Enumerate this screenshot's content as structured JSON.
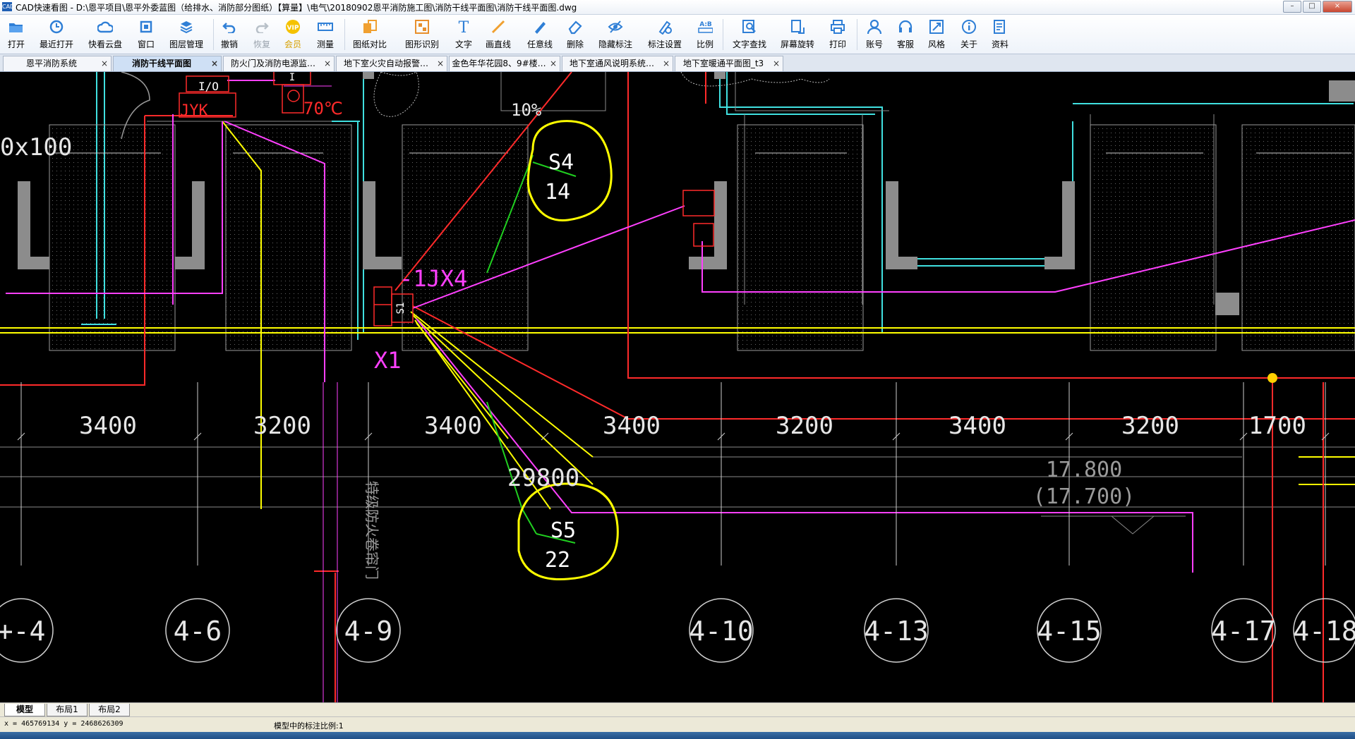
{
  "window": {
    "title": "CAD快速看图 - D:\\恩平项目\\恩平外委蓝图（给排水、消防部分图纸）【算量】\\电气\\20180902恩平消防施工图\\消防干线平面图\\消防干线平面图.dwg",
    "app_icon_text": "CAD"
  },
  "toolbar": {
    "items": [
      {
        "id": "open",
        "label": "打开",
        "icon": "folder-icon"
      },
      {
        "id": "recent",
        "label": "最近打开",
        "icon": "recent-icon"
      },
      {
        "id": "cloud",
        "label": "快看云盘",
        "icon": "cloud-icon"
      },
      {
        "id": "window",
        "label": "窗口",
        "icon": "window-icon"
      },
      {
        "id": "layers",
        "label": "图层管理",
        "icon": "layers-icon"
      },
      {
        "id": "undo",
        "label": "撤销",
        "icon": "undo-icon"
      },
      {
        "id": "redo",
        "label": "恢复",
        "icon": "redo-icon",
        "disabled": true
      },
      {
        "id": "vip",
        "label": "会员",
        "icon": "vip-icon"
      },
      {
        "id": "measure",
        "label": "测量",
        "icon": "measure-icon"
      },
      {
        "id": "compare",
        "label": "图纸对比",
        "icon": "compare-icon"
      },
      {
        "id": "recognize",
        "label": "图形识别",
        "icon": "recognize-icon"
      },
      {
        "id": "text",
        "label": "文字",
        "icon": "text-icon"
      },
      {
        "id": "line",
        "label": "画直线",
        "icon": "line-icon"
      },
      {
        "id": "freeline",
        "label": "任意线",
        "icon": "pen-icon"
      },
      {
        "id": "delete",
        "label": "删除",
        "icon": "eraser-icon"
      },
      {
        "id": "hidemark",
        "label": "隐藏标注",
        "icon": "hide-icon"
      },
      {
        "id": "marksettings",
        "label": "标注设置",
        "icon": "settings-icon"
      },
      {
        "id": "scale",
        "label": "比例",
        "icon": "scale-icon"
      },
      {
        "id": "textsearch",
        "label": "文字查找",
        "icon": "search-icon"
      },
      {
        "id": "rotate",
        "label": "屏幕旋转",
        "icon": "rotate-icon"
      },
      {
        "id": "print",
        "label": "打印",
        "icon": "printer-icon"
      },
      {
        "id": "account",
        "label": "账号",
        "icon": "user-icon"
      },
      {
        "id": "service",
        "label": "客服",
        "icon": "headset-icon"
      },
      {
        "id": "style",
        "label": "风格",
        "icon": "style-icon"
      },
      {
        "id": "about",
        "label": "关于",
        "icon": "info-icon"
      },
      {
        "id": "docs",
        "label": "资料",
        "icon": "docs-icon"
      }
    ],
    "vip_text": "VIP",
    "text_tool_glyph": "T",
    "scale_glyph": "A:B"
  },
  "tabs": [
    {
      "label": "恩平消防系统",
      "active": false,
      "close": "×"
    },
    {
      "label": "消防干线平面图",
      "active": true,
      "close": "×"
    },
    {
      "label": "防火门及消防电源监…",
      "active": false,
      "close": "×"
    },
    {
      "label": "地下室火灾自动报警…",
      "active": false,
      "close": "×"
    },
    {
      "label": "金色年华花园8、9#楼…",
      "active": false,
      "close": "×"
    },
    {
      "label": "地下室通风说明系统…",
      "active": false,
      "close": "×"
    },
    {
      "label": "地下室暖通平面图_t3",
      "active": false,
      "close": "×"
    }
  ],
  "drawing": {
    "dimensions": [
      "3400",
      "3200",
      "3400",
      "3400",
      "3200",
      "3400",
      "3200",
      "1700"
    ],
    "total_dimension": "29800",
    "axes": [
      "+-4",
      "4-6",
      "4-9",
      "4-10",
      "4-13",
      "4-15",
      "4-17",
      "4-18"
    ],
    "labels": {
      "jyk": "JYK",
      "io": "I/O",
      "i": "I",
      "temp": "70℃",
      "slope": "10%",
      "beam": "0x100",
      "s4": "S4",
      "s4_num": "14",
      "s5": "S5",
      "s5_num": "22",
      "ijx4": "-1JX4",
      "x1": "X1",
      "s1": "S1",
      "elev1": "17.800",
      "elev2": "(17.700)",
      "fire_shutter": "特级防火卷帘门"
    },
    "colors": {
      "yellow": "#ffff00",
      "red": "#ff2a2a",
      "magenta": "#ff40ff",
      "cyan": "#40e0e0",
      "green": "#20d020",
      "gray": "#888888",
      "white": "#e6e6e6"
    }
  },
  "layout_tabs": [
    {
      "label": "模型",
      "active": true
    },
    {
      "label": "布局1",
      "active": false
    },
    {
      "label": "布局2",
      "active": false
    }
  ],
  "status": {
    "coords": "x = 465769134  y = 2468626309",
    "scale_text": "模型中的标注比例:1"
  },
  "window_buttons": {
    "minimize": "–",
    "maximize": "□",
    "close": "×"
  }
}
